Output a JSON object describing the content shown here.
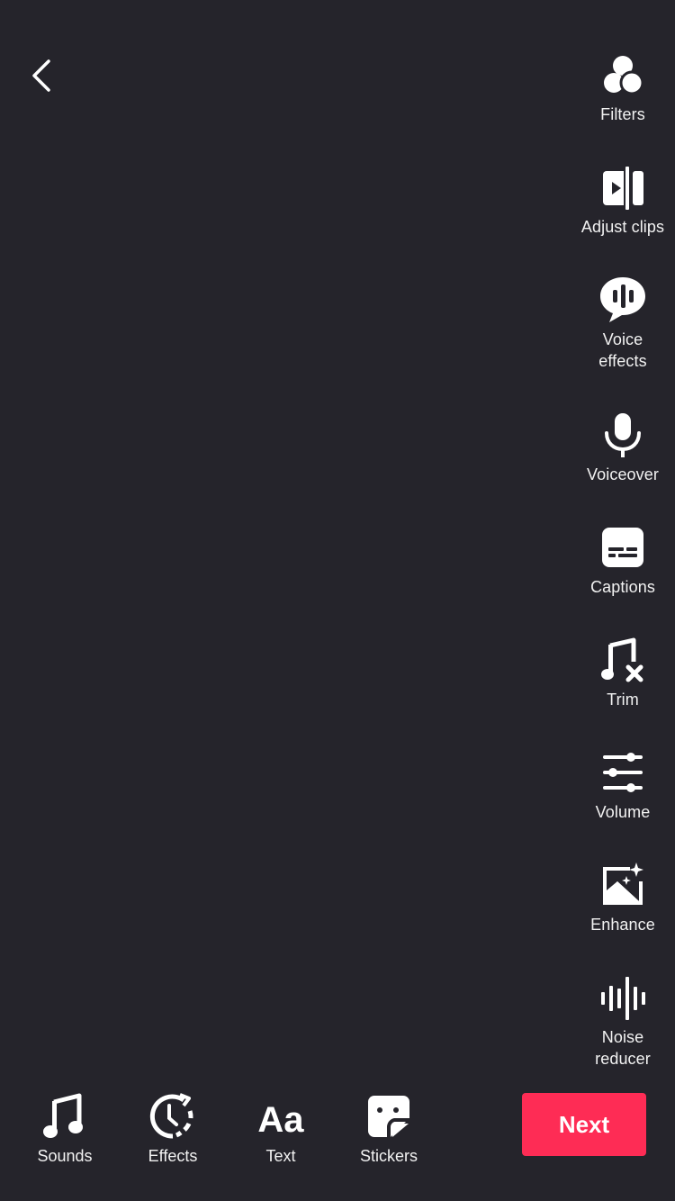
{
  "header": {
    "back_icon": "chevron-left-icon"
  },
  "side_tools": [
    {
      "id": "filters",
      "label": "Filters",
      "icon": "filters-icon"
    },
    {
      "id": "adjust-clips",
      "label": "Adjust clips",
      "icon": "adjust-clips-icon"
    },
    {
      "id": "voice-effects",
      "label": "Voice\neffects",
      "icon": "voice-effects-icon"
    },
    {
      "id": "voiceover",
      "label": "Voiceover",
      "icon": "microphone-icon"
    },
    {
      "id": "captions",
      "label": "Captions",
      "icon": "captions-icon"
    },
    {
      "id": "trim",
      "label": "Trim",
      "icon": "music-trim-icon"
    },
    {
      "id": "volume",
      "label": "Volume",
      "icon": "sliders-icon"
    },
    {
      "id": "enhance",
      "label": "Enhance",
      "icon": "enhance-image-icon"
    },
    {
      "id": "noise-reducer",
      "label": "Noise\nreducer",
      "icon": "waveform-icon"
    }
  ],
  "bottom_tools": [
    {
      "id": "sounds",
      "label": "Sounds",
      "icon": "music-note-icon"
    },
    {
      "id": "effects",
      "label": "Effects",
      "icon": "effects-clock-icon"
    },
    {
      "id": "text",
      "label": "Text",
      "icon": "text-aa-icon"
    },
    {
      "id": "stickers",
      "label": "Stickers",
      "icon": "sticker-icon"
    }
  ],
  "next_button": {
    "label": "Next",
    "color": "#fe2c55"
  },
  "colors": {
    "background": "#25242b",
    "text": "#ffffff",
    "accent": "#fe2c55"
  }
}
